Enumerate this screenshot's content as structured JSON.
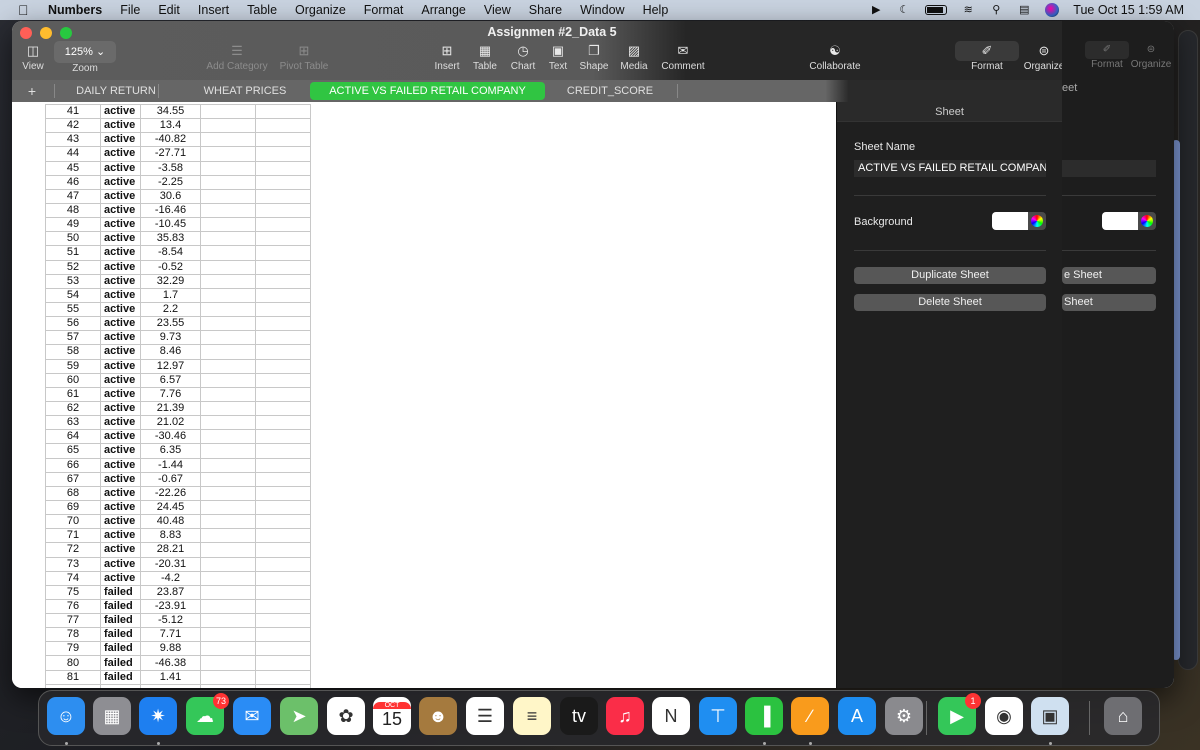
{
  "menubar": {
    "app": "Numbers",
    "items": [
      "File",
      "Edit",
      "Insert",
      "Table",
      "Organize",
      "Format",
      "Arrange",
      "View",
      "Share",
      "Window",
      "Help"
    ],
    "clock": "Tue Oct 15  1:59 AM"
  },
  "window": {
    "title": "Assignmen #2_Data 5",
    "toolbar": {
      "view": "View",
      "zoom_label": "Zoom",
      "zoom_value": "125% ⌄",
      "add_category": "Add Category",
      "pivot_table": "Pivot Table",
      "insert": "Insert",
      "table": "Table",
      "chart": "Chart",
      "text": "Text",
      "shape": "Shape",
      "media": "Media",
      "comment": "Comment",
      "collaborate": "Collaborate",
      "format": "Format",
      "organize": "Organize"
    },
    "tabs": [
      {
        "label": "DAILY RETURN",
        "active": false
      },
      {
        "label": "WHEAT PRICES",
        "active": false
      },
      {
        "label": "ACTIVE VS FAILED RETAIL COMPANY",
        "active": true
      },
      {
        "label": "CREDIT_SCORE",
        "active": false
      }
    ],
    "add_sheet": "+"
  },
  "table": {
    "rows": [
      [
        "41",
        "active",
        "34.55"
      ],
      [
        "42",
        "active",
        "13.4"
      ],
      [
        "43",
        "active",
        "-40.82"
      ],
      [
        "44",
        "active",
        "-27.71"
      ],
      [
        "45",
        "active",
        "-3.58"
      ],
      [
        "46",
        "active",
        "-2.25"
      ],
      [
        "47",
        "active",
        "30.6"
      ],
      [
        "48",
        "active",
        "-16.46"
      ],
      [
        "49",
        "active",
        "-10.45"
      ],
      [
        "50",
        "active",
        "35.83"
      ],
      [
        "51",
        "active",
        "-8.54"
      ],
      [
        "52",
        "active",
        "-0.52"
      ],
      [
        "53",
        "active",
        "32.29"
      ],
      [
        "54",
        "active",
        "1.7"
      ],
      [
        "55",
        "active",
        "2.2"
      ],
      [
        "56",
        "active",
        "23.55"
      ],
      [
        "57",
        "active",
        "9.73"
      ],
      [
        "58",
        "active",
        "8.46"
      ],
      [
        "59",
        "active",
        "12.97"
      ],
      [
        "60",
        "active",
        "6.57"
      ],
      [
        "61",
        "active",
        "7.76"
      ],
      [
        "62",
        "active",
        "21.39"
      ],
      [
        "63",
        "active",
        "21.02"
      ],
      [
        "64",
        "active",
        "-30.46"
      ],
      [
        "65",
        "active",
        "6.35"
      ],
      [
        "66",
        "active",
        "-1.44"
      ],
      [
        "67",
        "active",
        "-0.67"
      ],
      [
        "68",
        "active",
        "-22.26"
      ],
      [
        "69",
        "active",
        "24.45"
      ],
      [
        "70",
        "active",
        "40.48"
      ],
      [
        "71",
        "active",
        "8.83"
      ],
      [
        "72",
        "active",
        "28.21"
      ],
      [
        "73",
        "active",
        "-20.31"
      ],
      [
        "74",
        "active",
        "-4.2"
      ],
      [
        "75",
        "failed",
        "23.87"
      ],
      [
        "76",
        "failed",
        "-23.91"
      ],
      [
        "77",
        "failed",
        "-5.12"
      ],
      [
        "78",
        "failed",
        "7.71"
      ],
      [
        "79",
        "failed",
        "9.88"
      ],
      [
        "80",
        "failed",
        "-46.38"
      ],
      [
        "81",
        "failed",
        "1.41"
      ]
    ]
  },
  "inspector": {
    "title": "Sheet",
    "sheet_name_label": "Sheet Name",
    "sheet_name_value": "ACTIVE VS FAILED RETAIL COMPANY",
    "background_label": "Background",
    "background_color": "#ffffff",
    "duplicate_sheet": "Duplicate Sheet",
    "delete_sheet": "Delete Sheet"
  },
  "ghost_window": {
    "format": "Format",
    "organize": "Organize",
    "sheet_fragment": "eet",
    "duplicate_fragment": "e Sheet",
    "delete_fragment": "Sheet"
  },
  "dock": {
    "apps": [
      {
        "name": "finder",
        "glyph": "☺",
        "color": "#2d8ef0",
        "running": true
      },
      {
        "name": "launchpad",
        "glyph": "▦",
        "color": "#8e8e93",
        "running": false
      },
      {
        "name": "safari",
        "glyph": "✷",
        "color": "#1e7ff0",
        "running": true
      },
      {
        "name": "messages",
        "glyph": "☁",
        "color": "#34c759",
        "running": false,
        "badge": "73"
      },
      {
        "name": "mail",
        "glyph": "✉",
        "color": "#2a8cf5",
        "running": false
      },
      {
        "name": "maps",
        "glyph": "➤",
        "color": "#6cc06a",
        "running": false
      },
      {
        "name": "photos",
        "glyph": "✿",
        "color": "#ffffff",
        "running": false
      },
      {
        "name": "calendar",
        "glyph": "15",
        "color": "#ffffff",
        "running": false,
        "month": "OCT"
      },
      {
        "name": "contacts",
        "glyph": "☻",
        "color": "#a57a3e",
        "running": false
      },
      {
        "name": "reminders",
        "glyph": "☰",
        "color": "#ffffff",
        "running": false
      },
      {
        "name": "notes",
        "glyph": "≡",
        "color": "#fff6c8",
        "running": false
      },
      {
        "name": "apple-tv",
        "glyph": "tv",
        "color": "#1a1a1a",
        "running": false
      },
      {
        "name": "music",
        "glyph": "♫",
        "color": "#fa2d48",
        "running": false
      },
      {
        "name": "news",
        "glyph": "N",
        "color": "#ffffff",
        "running": false
      },
      {
        "name": "keynote",
        "glyph": "⊤",
        "color": "#1f8ef1",
        "running": false
      },
      {
        "name": "numbers",
        "glyph": "▐",
        "color": "#2bc240",
        "running": true
      },
      {
        "name": "pages",
        "glyph": "∕",
        "color": "#f99b1c",
        "running": true
      },
      {
        "name": "app-store",
        "glyph": "A",
        "color": "#1d8cf0",
        "running": false
      },
      {
        "name": "system-settings",
        "glyph": "⚙",
        "color": "#8a8a8e",
        "running": false
      },
      {
        "name": "facetime",
        "glyph": "▶",
        "color": "#34c759",
        "running": false,
        "badge": "1"
      },
      {
        "name": "chrome",
        "glyph": "◉",
        "color": "#ffffff",
        "running": false
      },
      {
        "name": "preview",
        "glyph": "▣",
        "color": "#cfe0f0",
        "running": true
      },
      {
        "name": "trash",
        "glyph": "⌂",
        "color": "#6e6e72",
        "running": false
      }
    ]
  }
}
